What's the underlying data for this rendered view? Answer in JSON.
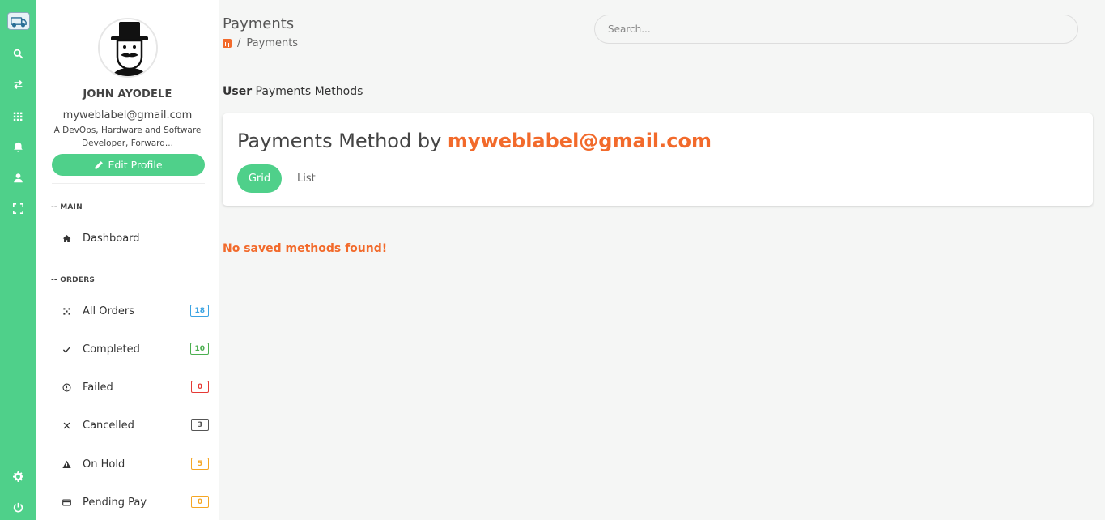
{
  "profile": {
    "name": "JOHN AYODELE",
    "email": "myweblabel@gmail.com",
    "bio": "A DevOps, Hardware and Software Developer, Forward...",
    "edit_label": "Edit Profile"
  },
  "sidebar": {
    "section_main": "-- MAIN",
    "section_orders": "-- ORDERS",
    "items": [
      {
        "label": "Dashboard",
        "icon": "home-icon"
      },
      {
        "label": "All Orders",
        "icon": "orders-icon",
        "count": "18",
        "color": "#3aa3e3"
      },
      {
        "label": "Completed",
        "icon": "check-icon",
        "count": "10",
        "color": "#4caf50"
      },
      {
        "label": "Failed",
        "icon": "alert-circle-icon",
        "count": "0",
        "color": "#e53935"
      },
      {
        "label": "Cancelled",
        "icon": "close-icon",
        "count": "3",
        "color": "#555555"
      },
      {
        "label": "On Hold",
        "icon": "warning-icon",
        "count": "5",
        "color": "#f5a623"
      },
      {
        "label": "Pending Pay",
        "icon": "credit-card-icon",
        "count": "0",
        "color": "#f5a623"
      }
    ]
  },
  "header": {
    "title": "Payments",
    "breadcrumb_separator": "/",
    "breadcrumb_current": "Payments",
    "search_placeholder": "Search..."
  },
  "main": {
    "subheading_bold": "User",
    "subheading_rest": " Payments Methods",
    "card_title_prefix": "Payments Method by ",
    "card_title_email": "myweblabel@gmail.com",
    "tabs": [
      {
        "label": "Grid",
        "active": true
      },
      {
        "label": "List",
        "active": false
      }
    ],
    "empty_message": "No saved methods found!"
  },
  "colors": {
    "accent": "#4fd08a",
    "highlight": "#f26a2b"
  }
}
